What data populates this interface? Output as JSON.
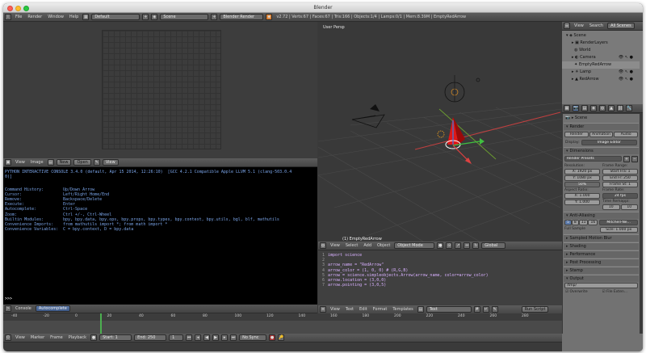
{
  "window": {
    "title": "Blender"
  },
  "info": {
    "menus": [
      "File",
      "Render",
      "Window",
      "Help"
    ],
    "layout": "Default",
    "scene": "Scene",
    "engine": "Blender Render",
    "stats": "v2.72 | Verts:67 | Faces:67 | Tris:166 | Objects:1/4 | Lamps:0/1 | Mem:8.39M | EmptyRedArrow"
  },
  "image_editor": {
    "menus": [
      "View",
      "Image"
    ],
    "new_label": "New",
    "open_label": "Open",
    "view_label": "View"
  },
  "viewport": {
    "title": "User Persp",
    "object_label": "(1) EmptyRedArrow",
    "menus": [
      "View",
      "Select",
      "Add",
      "Object"
    ],
    "mode": "Object Mode",
    "orientation": "Global"
  },
  "console": {
    "banner": "PYTHON INTERACTIVE CONSOLE 3.4.0 (default, Apr 15 2014, 12:26:10)  [GCC 4.2.1 Compatible Apple LLVM 5.1 (clang-503.0.4\n0)]",
    "help_keys": [
      "Command History:",
      "Cursor:",
      "Remove:",
      "Execute:",
      "Autocomplete:",
      "Zoom:",
      "Builtin Modules:",
      "Convenience Imports:",
      "Convenience Variables:"
    ],
    "help_vals": [
      "Up/Down Arrow",
      "Left/Right Home/End",
      "Backspace/Delete",
      "Enter",
      "Ctrl-Space",
      "Ctrl +/-, Ctrl-Wheel",
      "bpy, bpy.data, bpy.ops, bpy.props, bpy.types, bpy.context, bpy.utils, bgl, blf, mathutils",
      "from mathutils import *; from math import *",
      "C = bpy.context, D = bpy.data"
    ],
    "prompt": ">>>",
    "tabs": [
      "Console",
      "Autocomplete"
    ]
  },
  "text_editor": {
    "code": "import science\n\narrow_name = \"RedArrow\"\narrow_color = (1, 0, 0) # (R,G,B)\narrow = science.simpleobjects.Arrow(arrow_name, color=arrow_color)\narrow.location = (3,0,0)\narrow.pointing = (3,0,5)",
    "line_numbers": [
      "1",
      "2",
      "3",
      "4",
      "5",
      "6",
      "7"
    ],
    "menus": [
      "View",
      "Text",
      "Edit",
      "Format",
      "Templates"
    ],
    "file": "Text",
    "run_label": "Run Script"
  },
  "outliner": {
    "menus": [
      "View",
      "Search",
      "All Scenes"
    ],
    "items": [
      "Scene",
      "RenderLayers",
      "World",
      "Camera",
      "EmptyRedArrow",
      "Lamp",
      "RedArrow"
    ]
  },
  "properties": {
    "scene_label": "Scene",
    "panels": [
      "Render",
      "Dimensions",
      "Anti-Aliasing",
      "Sampled Motion Blur",
      "Shading",
      "Performance",
      "Post Processing",
      "Stamp",
      "Output"
    ],
    "render_buttons": [
      "Render",
      "Animation",
      "Audio"
    ],
    "display_label": "Display:",
    "display_value": "Image Editor",
    "presets": "Render Presets",
    "resolution_label": "Resolution:",
    "res_x": "X: 1920 px",
    "res_y": "Y: 1080 px",
    "res_pct": "50%",
    "frame_range_label": "Frame Range:",
    "start_frame": "Start Fra: 1",
    "end_frame": "End Fr: 250",
    "frame_step": "Frame St: 1",
    "aspect_label": "Aspect Ratio:",
    "asp_x": "X: 1.000",
    "asp_y": "Y: 1.000",
    "frame_rate_label": "Frame Rate:",
    "fps": "24 fps",
    "time_remap_label": "Time Remappi:",
    "remap_old": "10",
    "remap_new": "10",
    "aa_samples": [
      "5",
      "8",
      "11",
      "16"
    ],
    "aa_filter": "Mitchell-Ne...",
    "full_sample": "Full Sample",
    "filter_size": "Size: 1.000 px",
    "output_path": "/tmp/",
    "overwrite": "Overwrite",
    "file_extensions": "File Exten..."
  },
  "timeline": {
    "ticks": [
      "-40",
      "-20",
      "0",
      "20",
      "40",
      "60",
      "80",
      "100",
      "120",
      "140",
      "160",
      "180",
      "200",
      "220",
      "240",
      "260",
      "280"
    ],
    "menus": [
      "View",
      "Marker",
      "Frame",
      "Playback"
    ],
    "start": "Start: 1",
    "end": "End: 250",
    "current": "1",
    "sync": "No Sync"
  }
}
